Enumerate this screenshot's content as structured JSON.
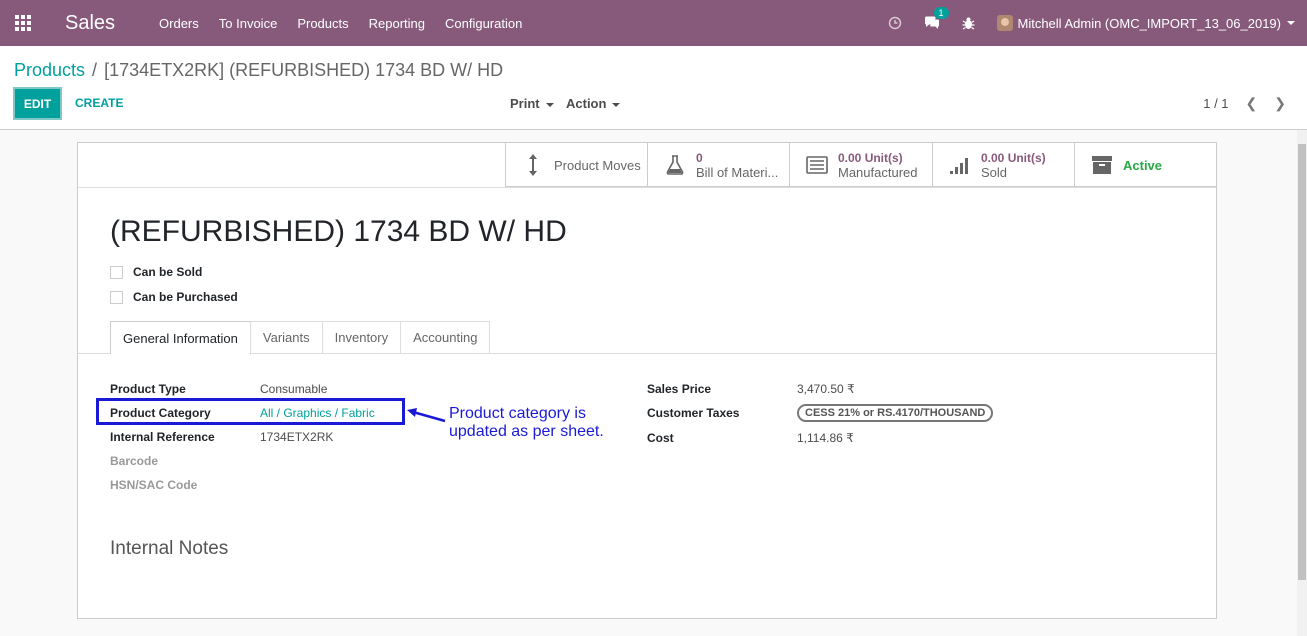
{
  "topbar": {
    "app_name": "Sales",
    "menu": [
      "Orders",
      "To Invoice",
      "Products",
      "Reporting",
      "Configuration"
    ],
    "message_count": "1",
    "user": "Mitchell Admin (OMC_IMPORT_13_06_2019)",
    "icons": [
      "apps-grid-icon",
      "clock-icon",
      "chat-icon",
      "bug-icon",
      "avatar"
    ]
  },
  "breadcrumb": {
    "parent": "Products",
    "separator": "/",
    "current": "[1734ETX2RK] (REFURBISHED) 1734 BD W/ HD"
  },
  "toolbar": {
    "edit": "EDIT",
    "create": "CREATE",
    "print": "Print",
    "action": "Action"
  },
  "pager": {
    "value": "1 / 1"
  },
  "stats": {
    "product_moves": {
      "label": "Product Moves"
    },
    "bom": {
      "value": "0",
      "label": "Bill of Materi..."
    },
    "manufactured": {
      "value": "0.00 Unit(s)",
      "label": "Manufactured"
    },
    "sold": {
      "value": "0.00 Unit(s)",
      "label": "Sold"
    },
    "active": {
      "label": "Active"
    }
  },
  "product": {
    "title": "(REFURBISHED) 1734 BD W/ HD",
    "can_be_sold": "Can be Sold",
    "can_be_purchased": "Can be Purchased"
  },
  "tabs": [
    "General Information",
    "Variants",
    "Inventory",
    "Accounting"
  ],
  "fields_left": [
    {
      "label": "Product Type",
      "value": "Consumable"
    },
    {
      "label": "Product Category",
      "value": "All / Graphics / Fabric"
    },
    {
      "label": "Internal Reference",
      "value": "1734ETX2RK"
    },
    {
      "label": "Barcode",
      "value": ""
    },
    {
      "label": "HSN/SAC Code",
      "value": ""
    }
  ],
  "fields_right": [
    {
      "label": "Sales Price",
      "value": "3,470.50 ₹"
    },
    {
      "label": "Customer Taxes",
      "value": "CESS 21% or RS.4170/THOUSAND"
    },
    {
      "label": "Cost",
      "value": "1,114.86 ₹"
    }
  ],
  "annotation": {
    "line1": "Product category is",
    "line2": "updated as per sheet."
  },
  "notes_heading": "Internal Notes",
  "colors": {
    "brand": "#875a7b",
    "accent": "#00a09d",
    "annotation": "#1a1ad6",
    "active": "#28a745"
  }
}
